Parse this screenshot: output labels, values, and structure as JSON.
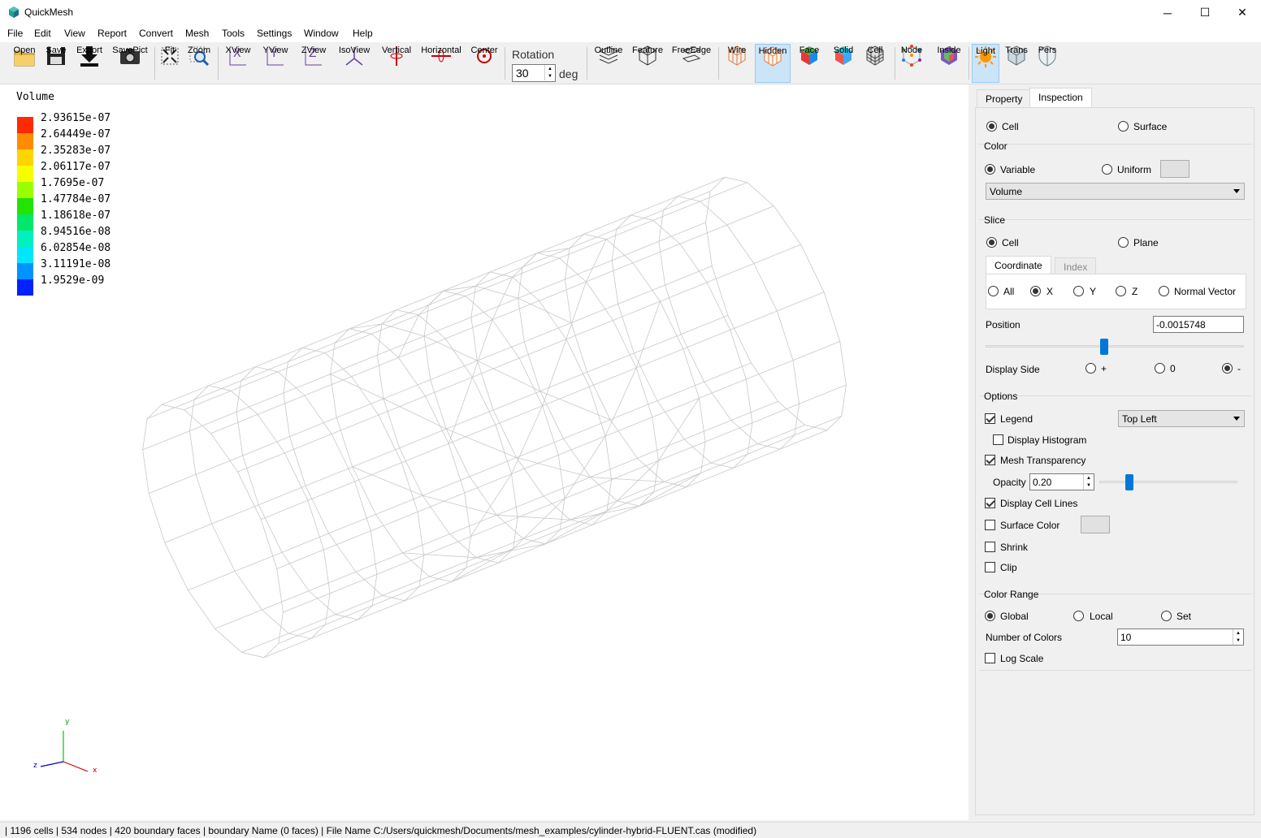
{
  "window": {
    "title": "QuickMesh",
    "minimize": "─",
    "maximize": "☐",
    "close": "✕"
  },
  "menu": [
    "File",
    "Edit",
    "View",
    "Report",
    "Convert",
    "Mesh",
    "Tools",
    "Settings",
    "Window",
    "Help"
  ],
  "toolbar": {
    "open": "Open",
    "save": "Save",
    "export": "Export",
    "savepict": "SavePict",
    "fit": "Fit",
    "zoom": "Zoom",
    "xview": "XView",
    "yview": "YView",
    "zview": "ZView",
    "isoview": "IsoView",
    "vertical": "Vertical",
    "horizontal": "Horizontal",
    "center": "Center",
    "rotation_label": "Rotation",
    "rotation_value": "30",
    "rotation_unit": "deg",
    "outline": "Outline",
    "feature": "Feature",
    "freeedge": "FreeEdge",
    "wire": "Wire",
    "hidden": "Hidden",
    "face": "Face",
    "solid": "Solid",
    "cell": "Cell",
    "node": "Node",
    "inside": "Inside",
    "light": "Light",
    "trans": "Trans",
    "pers": "Pers"
  },
  "legend": {
    "title": "Volume",
    "entries": [
      {
        "value": "2.93615e-07",
        "color": "#ff2a00"
      },
      {
        "value": "2.64449e-07",
        "color": "#ff8c00"
      },
      {
        "value": "2.35283e-07",
        "color": "#ffd400"
      },
      {
        "value": "2.06117e-07",
        "color": "#f5ff00"
      },
      {
        "value": "1.7695e-07",
        "color": "#9aff00"
      },
      {
        "value": "1.47784e-07",
        "color": "#22e400"
      },
      {
        "value": "1.18618e-07",
        "color": "#00e86a"
      },
      {
        "value": "8.94516e-08",
        "color": "#00f0c0"
      },
      {
        "value": "6.02854e-08",
        "color": "#00e6ff"
      },
      {
        "value": "3.11191e-08",
        "color": "#0094ff"
      },
      {
        "value": "1.9529e-09",
        "color": "#0022ff"
      }
    ]
  },
  "axes": {
    "x": "x",
    "y": "y",
    "z": "z"
  },
  "panel": {
    "tabs": {
      "property": "Property",
      "inspection": "Inspection"
    },
    "mode_cell": "Cell",
    "mode_surface": "Surface",
    "color_group": "Color",
    "color_variable": "Variable",
    "color_uniform": "Uniform",
    "color_variable_value": "Volume",
    "slice_group": "Slice",
    "slice_cell": "Cell",
    "slice_plane": "Plane",
    "subtab_coordinate": "Coordinate",
    "subtab_index": "Index",
    "coord_all": "All",
    "coord_x": "X",
    "coord_y": "Y",
    "coord_z": "Z",
    "coord_normal": "Normal Vector",
    "position_label": "Position",
    "position_value": "-0.0015748",
    "display_side_label": "Display Side",
    "side_plus": "+",
    "side_zero": "0",
    "side_minus": "-",
    "options_group": "Options",
    "legend_label": "Legend",
    "legend_position": "Top Left",
    "display_histogram": "Display Histogram",
    "mesh_transparency": "Mesh Transparency",
    "opacity_label": "Opacity",
    "opacity_value": "0.20",
    "display_cell_lines": "Display Cell Lines",
    "surface_color": "Surface Color",
    "shrink": "Shrink",
    "clip": "Clip",
    "color_range_group": "Color Range",
    "range_global": "Global",
    "range_local": "Local",
    "range_set": "Set",
    "num_colors_label": "Number of Colors",
    "num_colors_value": "10",
    "log_scale": "Log Scale"
  },
  "status": "| 1196 cells | 534 nodes | 420 boundary faces |  boundary Name  (0 faces) | File Name C:/Users/quickmesh/Documents/mesh_examples/cylinder-hybrid-FLUENT.cas (modified)"
}
